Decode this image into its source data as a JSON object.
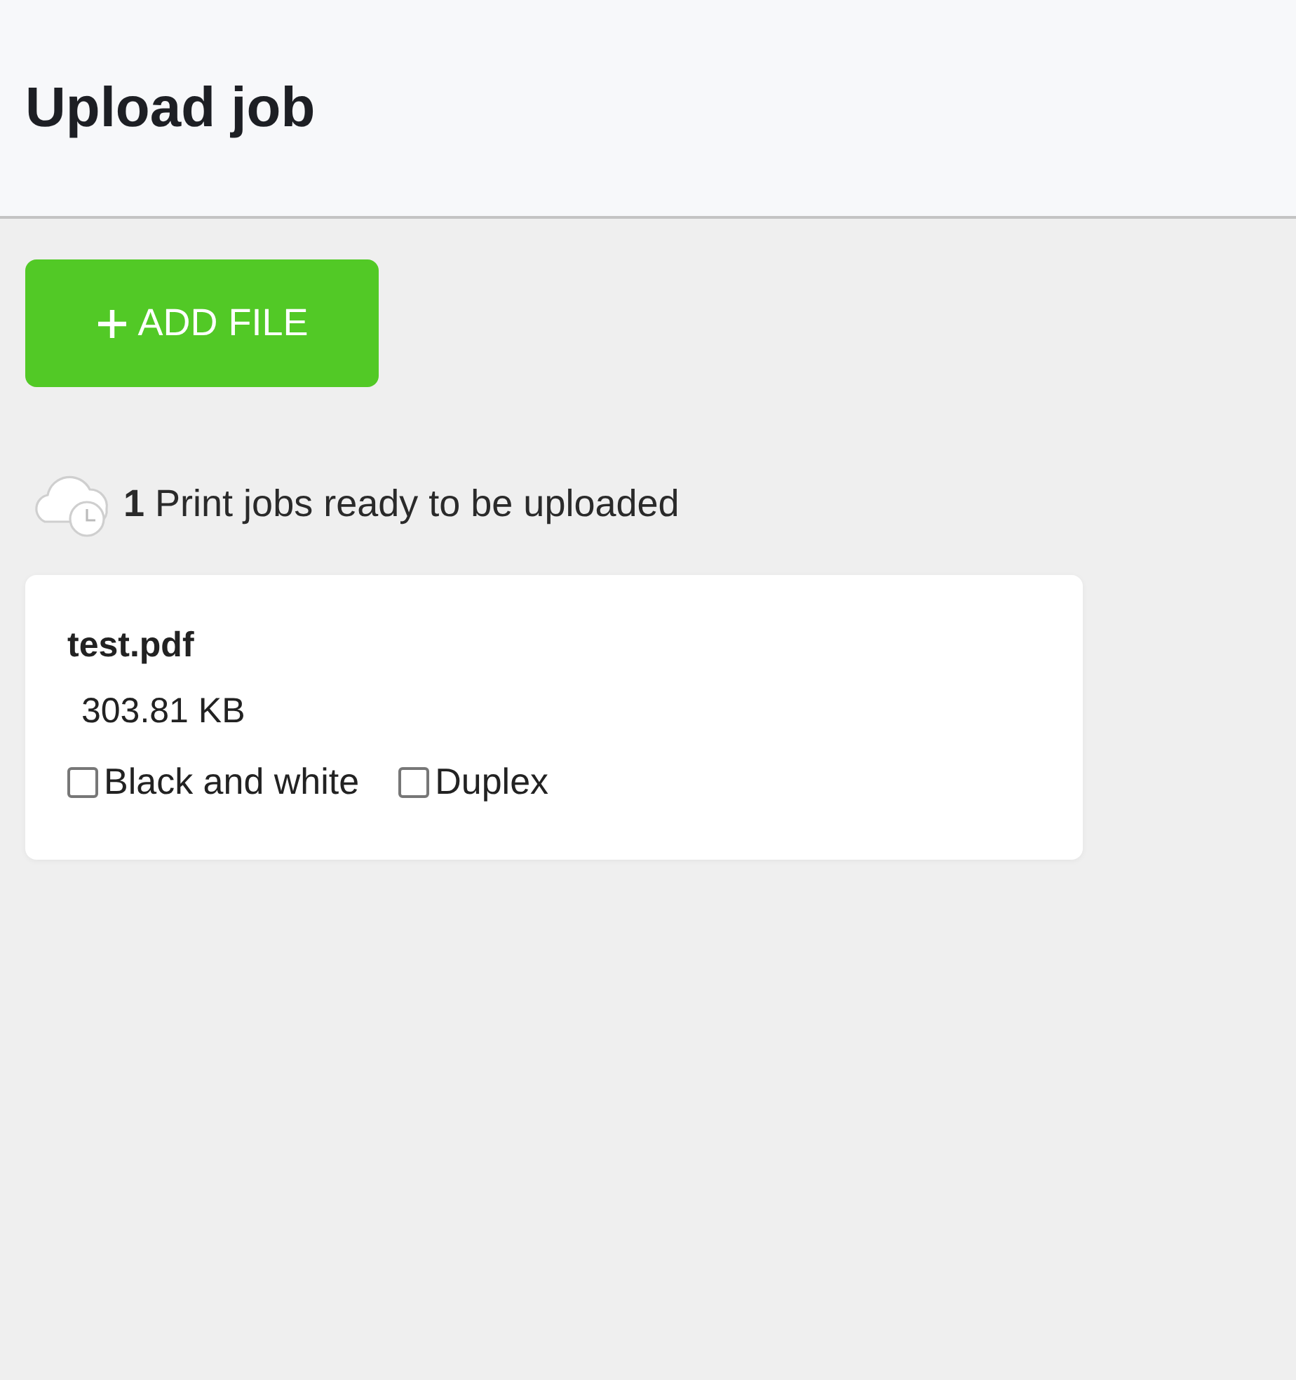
{
  "header": {
    "title": "Upload job"
  },
  "add_button": {
    "label": "ADD FILE"
  },
  "status": {
    "text": "**1** Print jobs ready to be uploaded"
  },
  "jobs": [
    {
      "file_name": "test.pdf",
      "size": "303.81 KB",
      "options": [
        {
          "label": "Black and white",
          "checked": false
        },
        {
          "label": "Duplex",
          "checked": false
        }
      ]
    }
  ]
}
